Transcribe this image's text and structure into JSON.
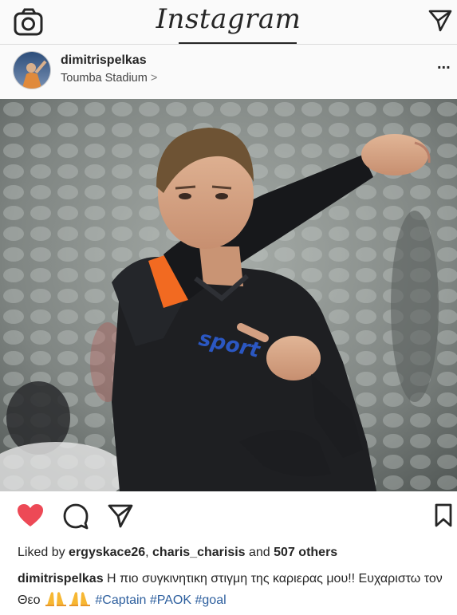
{
  "app": {
    "title": "Instagram"
  },
  "post": {
    "username": "dimitrispelkas",
    "location": "Toumba Stadium",
    "location_chevron": ">",
    "more": "...",
    "photo": {
      "jersey_text": "sport",
      "armband_color": "#f26a21",
      "jersey_color": "#1e1f22"
    },
    "liked_by_prefix": "Liked by ",
    "liked_user_1": "ergyskace26",
    "liked_sep": ", ",
    "liked_user_2": "charis_charisis",
    "liked_and": " and ",
    "liked_others": "507 others",
    "caption_user": "dimitrispelkas",
    "caption_text": " Η πιο συγκινητικη στιγμη της καριερας μου!! Ευχαριστω τον Θεο ",
    "caption_emojis": "praying-hands",
    "hashtags": [
      "#Captain",
      "#PAOK",
      "#goal"
    ]
  },
  "icons": {
    "camera": "camera-icon",
    "direct": "paper-plane-icon",
    "like": "heart-icon",
    "comment": "comment-icon",
    "share": "paper-plane-icon",
    "save": "bookmark-icon",
    "pray": "praying-hands-icon"
  },
  "colors": {
    "like": "#ed4956",
    "hashtag": "#2d5f9e",
    "text": "#262626"
  }
}
